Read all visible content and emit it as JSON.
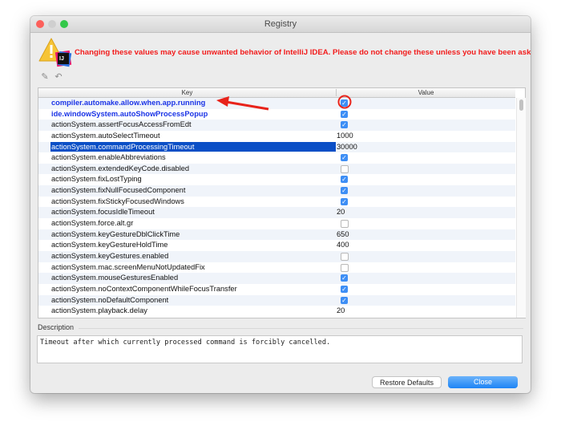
{
  "window": {
    "title": "Registry"
  },
  "warning": "Changing these values may cause unwanted behavior of IntelliJ IDEA. Please do not change these unless you have been asked.",
  "logo_text": "IJ",
  "table": {
    "columns": [
      "Key",
      "Value"
    ],
    "rows": [
      {
        "key": "compiler.automake.allow.when.app.running",
        "type": "bool",
        "value": true,
        "modified": true
      },
      {
        "key": "ide.windowSystem.autoShowProcessPopup",
        "type": "bool",
        "value": true,
        "modified": true
      },
      {
        "key": "actionSystem.assertFocusAccessFromEdt",
        "type": "bool",
        "value": true
      },
      {
        "key": "actionSystem.autoSelectTimeout",
        "type": "text",
        "value": "1000"
      },
      {
        "key": "actionSystem.commandProcessingTimeout",
        "type": "text",
        "value": "30000",
        "selected": true
      },
      {
        "key": "actionSystem.enableAbbreviations",
        "type": "bool",
        "value": true
      },
      {
        "key": "actionSystem.extendedKeyCode.disabled",
        "type": "bool",
        "value": false
      },
      {
        "key": "actionSystem.fixLostTyping",
        "type": "bool",
        "value": true
      },
      {
        "key": "actionSystem.fixNullFocusedComponent",
        "type": "bool",
        "value": true
      },
      {
        "key": "actionSystem.fixStickyFocusedWindows",
        "type": "bool",
        "value": true
      },
      {
        "key": "actionSystem.focusIdleTimeout",
        "type": "text",
        "value": "20"
      },
      {
        "key": "actionSystem.force.alt.gr",
        "type": "bool",
        "value": false
      },
      {
        "key": "actionSystem.keyGestureDblClickTime",
        "type": "text",
        "value": "650"
      },
      {
        "key": "actionSystem.keyGestureHoldTime",
        "type": "text",
        "value": "400"
      },
      {
        "key": "actionSystem.keyGestures.enabled",
        "type": "bool",
        "value": false
      },
      {
        "key": "actionSystem.mac.screenMenuNotUpdatedFix",
        "type": "bool",
        "value": false
      },
      {
        "key": "actionSystem.mouseGesturesEnabled",
        "type": "bool",
        "value": true
      },
      {
        "key": "actionSystem.noContextComponentWhileFocusTransfer",
        "type": "bool",
        "value": true
      },
      {
        "key": "actionSystem.noDefaultComponent",
        "type": "bool",
        "value": true
      },
      {
        "key": "actionSystem.playback.delay",
        "type": "text",
        "value": "20"
      }
    ]
  },
  "description": {
    "label": "Description",
    "text": "Timeout after which currently processed command is forcibly cancelled."
  },
  "buttons": {
    "restore": "Restore Defaults",
    "close": "Close"
  },
  "colors": {
    "accent": "#1d84f5",
    "warning": "#f21c1c",
    "modified_key": "#1a33e6",
    "selection": "#0b4fc6",
    "annotation": "#e8231b"
  }
}
